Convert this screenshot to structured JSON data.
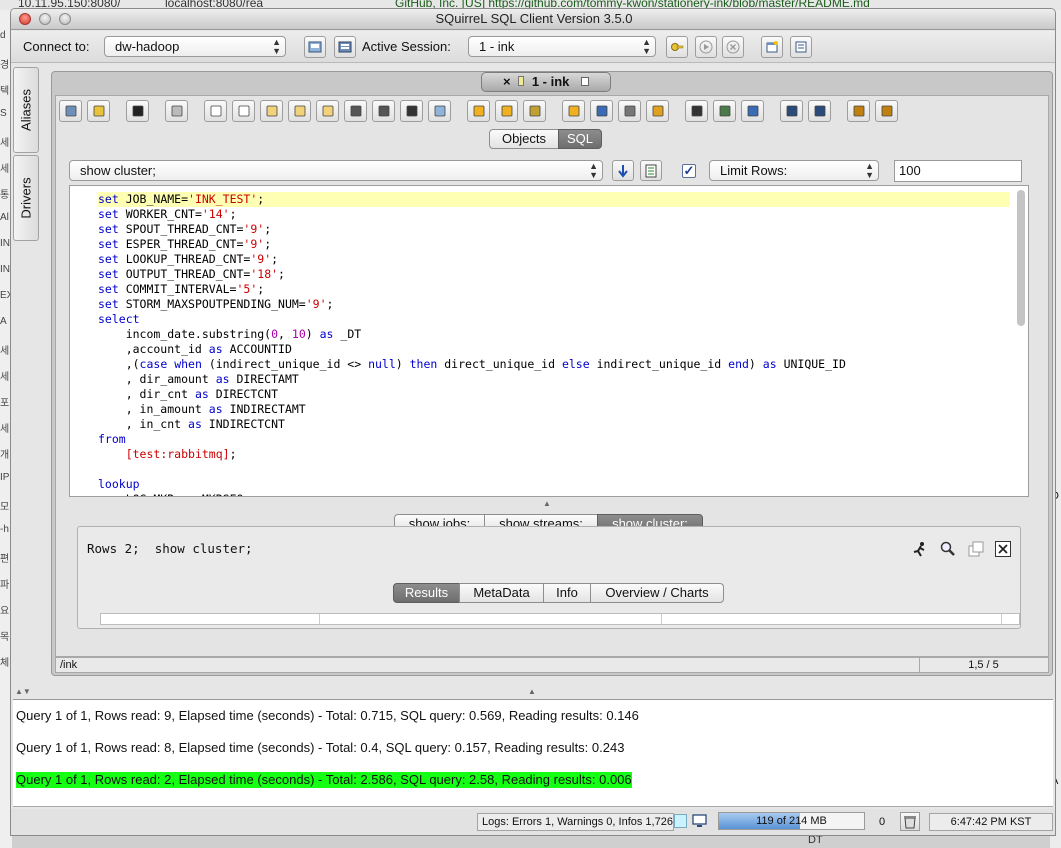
{
  "background": {
    "url_fragments": [
      "10.11.95.150:8080/",
      "localhost:8080/rea",
      "GitHub, Inc. [US] https://github.com/tommy-kwon/stationery-ink/blob/master/README.md"
    ],
    "left_fragments": [
      "d",
      "경",
      "텍",
      "S",
      "세",
      "세",
      "통",
      "Al",
      "INK",
      "IN",
      "EX",
      "A",
      "세",
      "세",
      "포",
      "세",
      "개",
      "IP",
      "모",
      "-h",
      "편",
      "파",
      "요",
      "목",
      "체"
    ],
    "right_fragments": [
      "D",
      "A"
    ],
    "below_window": "DT"
  },
  "window": {
    "title": "SQuirreL SQL Client Version 3.5.0"
  },
  "toolbar": {
    "connect_label": "Connect to:",
    "connect_value": "dw-hadoop",
    "session_label": "Active Session:",
    "session_value": "1 - ink"
  },
  "side_tabs": [
    "Aliases",
    "Drivers"
  ],
  "frame_tab": {
    "close": "×",
    "label": "1 - ink"
  },
  "view_tabs": [
    "Objects",
    "SQL"
  ],
  "sql_history": {
    "value": "show cluster;",
    "limit_label": "Limit Rows:",
    "limit_value": "100"
  },
  "editor": {
    "lines": [
      "set JOB_NAME='INK_TEST';",
      "set WORKER_CNT='14';",
      "set SPOUT_THREAD_CNT='9';",
      "set ESPER_THREAD_CNT='9';",
      "set LOOKUP_THREAD_CNT='9';",
      "set OUTPUT_THREAD_CNT='18';",
      "set COMMIT_INTERVAL='5';",
      "set STORM_MAXSPOUTPENDING_NUM='9';",
      "select",
      "    incom_date.substring(0, 10) as _DT",
      "    ,account_id as ACCOUNTID",
      "    ,(case when (indirect_unique_id <> null) then direct_unique_id else indirect_unique_id end) as UNIQUE_ID",
      "    , dir_amount as DIRECTAMT",
      "    , dir_cnt as DIRECTCNT",
      "    , in_amount as INDIRECTAMT",
      "    , in_cnt as INDIRECTCNT",
      "from",
      "    [test:rabbitmq];",
      "",
      "lookup",
      "    LOG_MKR as MKRSEQ"
    ]
  },
  "result_tabs": [
    "show jobs;",
    "show streams;",
    "show cluster;"
  ],
  "result": {
    "summary": "Rows 2;  show cluster;",
    "subtabs": [
      "Results",
      "MetaData",
      "Info",
      "Overview / Charts"
    ]
  },
  "status": {
    "path": "/ink",
    "position": "1,5 / 5"
  },
  "log": {
    "lines": [
      "Query 1 of 1, Rows read: 9, Elapsed time (seconds) - Total: 0.715, SQL query: 0.569, Reading results: 0.146",
      "Query 1 of 1, Rows read: 8, Elapsed time (seconds) - Total: 0.4, SQL query: 0.157, Reading results: 0.243",
      "Query 1 of 1, Rows read: 2, Elapsed time (seconds) - Total: 2.586, SQL query: 2.58, Reading results: 0.006"
    ]
  },
  "statusbar": {
    "logs": "Logs: Errors 1, Warnings 0, Infos 1,726",
    "memory": "119 of 214 MB",
    "memory_fraction": 0.556,
    "count": "0",
    "time": "6:47:42 PM KST"
  },
  "colors": {
    "success_highlight": "#15ff15",
    "current_line": "#ffffb3",
    "keyword": "#0000cc",
    "string": "#cc0000",
    "number": "#aa00aa"
  }
}
